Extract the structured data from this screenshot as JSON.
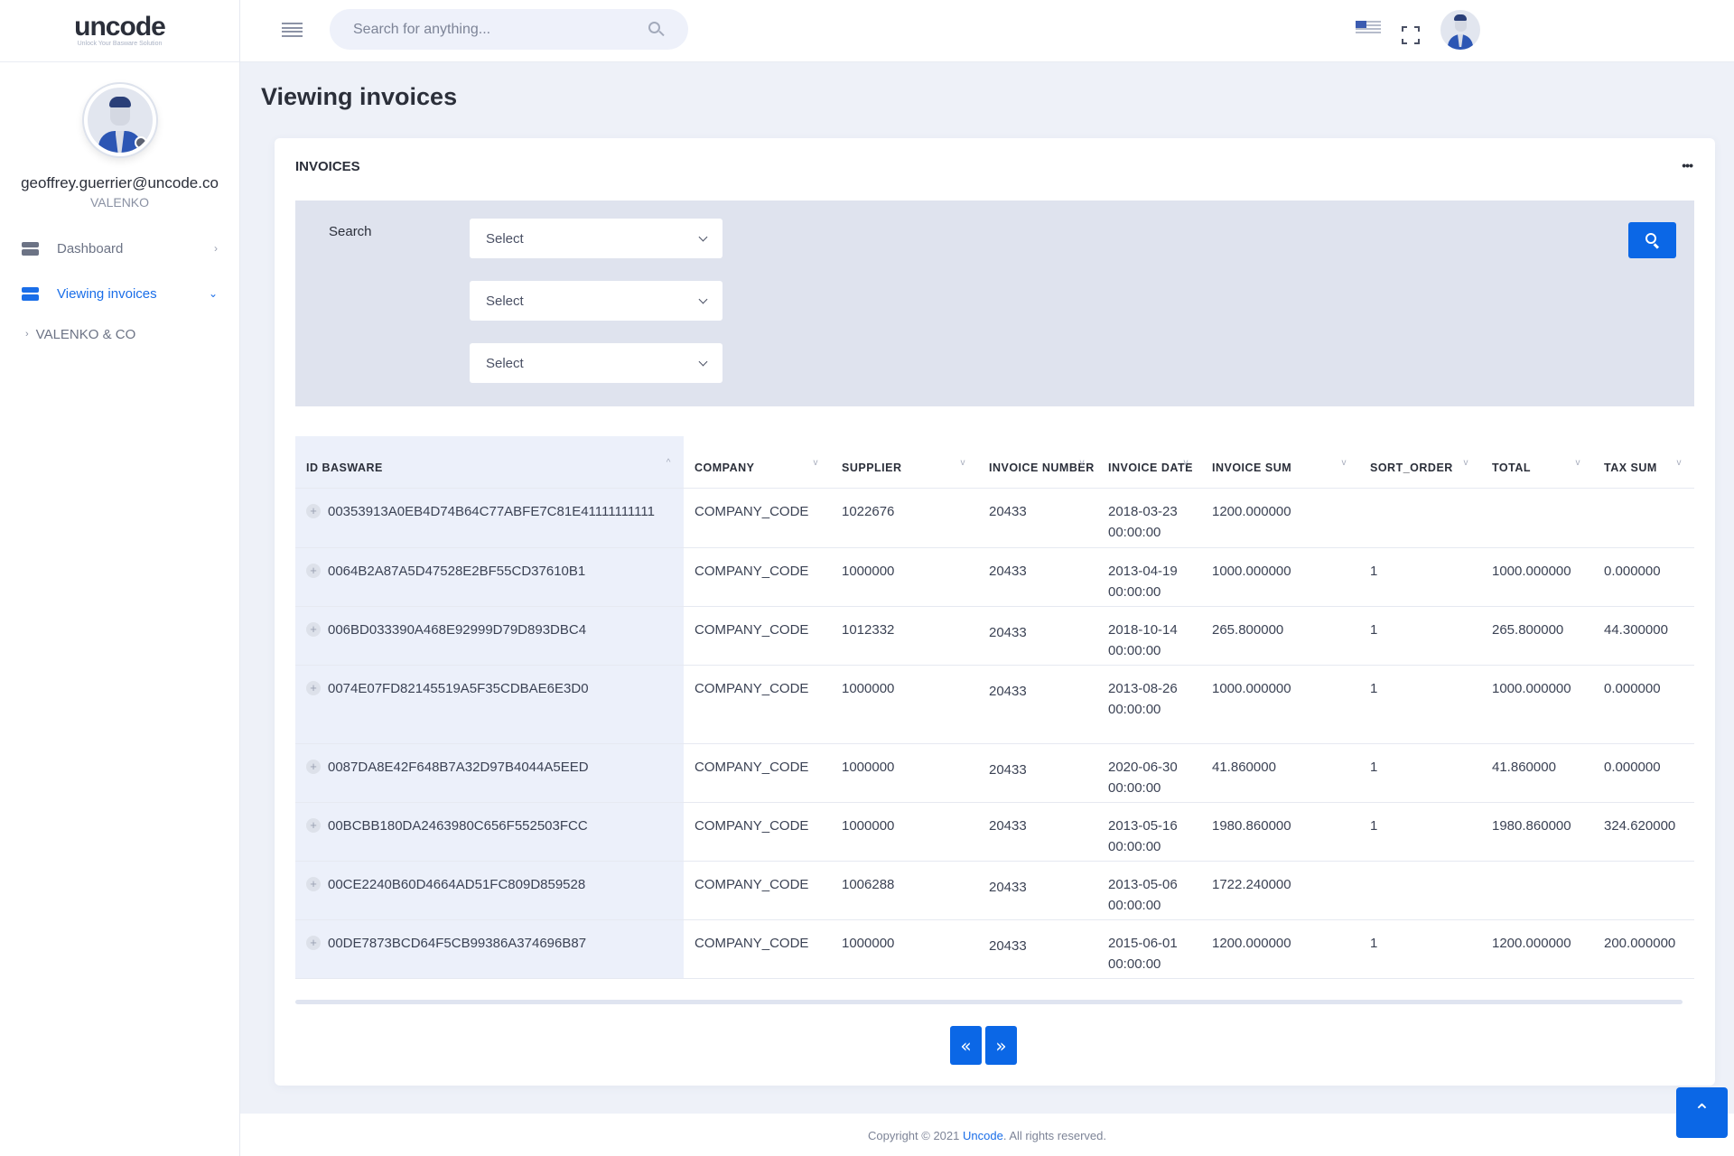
{
  "brand": {
    "logo": "uncode",
    "tagline": "Unlock Your Basware Solution"
  },
  "user": {
    "email": "geoffrey.guerrier@uncode.co",
    "company": "VALENKO"
  },
  "sidebar": {
    "items": [
      {
        "label": "Dashboard",
        "icon": "server-icon",
        "chevron": "›",
        "active": false
      },
      {
        "label": "Viewing invoices",
        "icon": "server-icon",
        "chevron": "⌄",
        "active": true
      }
    ],
    "sub_items": [
      {
        "label": "VALENKO & CO",
        "arrow": "›"
      }
    ]
  },
  "topbar": {
    "search_placeholder": "Search for anything...",
    "language": "en-US",
    "icons": [
      "menu-icon",
      "search-icon",
      "us-flag-icon",
      "fullscreen-icon",
      "avatar"
    ]
  },
  "page": {
    "title": "Viewing invoices"
  },
  "card": {
    "title": "INVOICES",
    "menu": "•••",
    "filter": {
      "label": "Search",
      "selects": [
        {
          "value": "Select"
        },
        {
          "value": "Select"
        },
        {
          "value": "Select"
        }
      ]
    }
  },
  "table": {
    "columns": [
      {
        "label": "ID BASWARE",
        "sort": "^"
      },
      {
        "label": "COMPANY",
        "sort": "v"
      },
      {
        "label": "SUPPLIER",
        "sort": "v"
      },
      {
        "label": "INVOICE NUMBER",
        "sort": "v"
      },
      {
        "label": "INVOICE DATE",
        "sort": "v"
      },
      {
        "label": "INVOICE SUM",
        "sort": "v"
      },
      {
        "label": "SORT_ORDER",
        "sort": "v"
      },
      {
        "label": "TOTAL",
        "sort": "v"
      },
      {
        "label": "TAX SUM",
        "sort": "v"
      }
    ],
    "rows": [
      {
        "id": "00353913A0EB4D74B64C77ABFE7C81E41111111111",
        "company": "COMPANY_CODE",
        "supplier": "1022676",
        "invoice_number": "20433",
        "invoice_date": "2018-03-23 00:00:00",
        "invoice_sum": "1200.000000",
        "sort_order": "",
        "total": "",
        "tax_sum": ""
      },
      {
        "id": "0064B2A87A5D47528E2BF55CD37610B1",
        "company": "COMPANY_CODE",
        "supplier": "1000000",
        "invoice_number": "20433",
        "invoice_date": "2013-04-19 00:00:00",
        "invoice_sum": "1000.000000",
        "sort_order": "1",
        "total": "1000.000000",
        "tax_sum": "0.000000"
      },
      {
        "id": "006BD033390A468E92999D79D893DBC4",
        "company": "COMPANY_CODE",
        "supplier": "1012332",
        "invoice_number": "20433",
        "invoice_date": "2018-10-14 00:00:00",
        "invoice_sum": "265.800000",
        "sort_order": "1",
        "total": "265.800000",
        "tax_sum": "44.300000"
      },
      {
        "id": "0074E07FD82145519A5F35CDBAE6E3D0",
        "company": "COMPANY_CODE",
        "supplier": "1000000",
        "invoice_number": "20433",
        "invoice_date": "2013-08-26 00:00:00",
        "invoice_sum": "1000.000000",
        "sort_order": "1",
        "total": "1000.000000",
        "tax_sum": "0.000000"
      },
      {
        "id": "0087DA8E42F648B7A32D97B4044A5EED",
        "company": "COMPANY_CODE",
        "supplier": "1000000",
        "invoice_number": "20433",
        "invoice_date": "2020-06-30 00:00:00",
        "invoice_sum": "41.860000",
        "sort_order": "1",
        "total": "41.860000",
        "tax_sum": "0.000000"
      },
      {
        "id": "00BCBB180DA2463980C656F552503FCC",
        "company": "COMPANY_CODE",
        "supplier": "1000000",
        "invoice_number": "20433",
        "invoice_date": "2013-05-16 00:00:00",
        "invoice_sum": "1980.860000",
        "sort_order": "1",
        "total": "1980.860000",
        "tax_sum": "324.620000"
      },
      {
        "id": "00CE2240B60D4664AD51FC809D859528",
        "company": "COMPANY_CODE",
        "supplier": "1006288",
        "invoice_number": "20433",
        "invoice_date": "2013-05-06 00:00:00",
        "invoice_sum": "1722.240000",
        "sort_order": "",
        "total": "",
        "tax_sum": ""
      },
      {
        "id": "00DE7873BCD64F5CB99386A374696B87",
        "company": "COMPANY_CODE",
        "supplier": "1000000",
        "invoice_number": "20433",
        "invoice_date": "2015-06-01 00:00:00",
        "invoice_sum": "1200.000000",
        "sort_order": "1",
        "total": "1200.000000",
        "tax_sum": "200.000000"
      }
    ]
  },
  "pagination": {
    "prev": "«",
    "next": "»"
  },
  "footer": {
    "prefix": "Copyright © 2021 ",
    "link": "Uncode",
    "suffix": ". All rights reserved."
  },
  "scroll_top": "⌃",
  "colors": {
    "accent": "#0b67e6",
    "link": "#1a6ee8",
    "panel": "#dfe3ee",
    "background": "#eef1f8"
  }
}
